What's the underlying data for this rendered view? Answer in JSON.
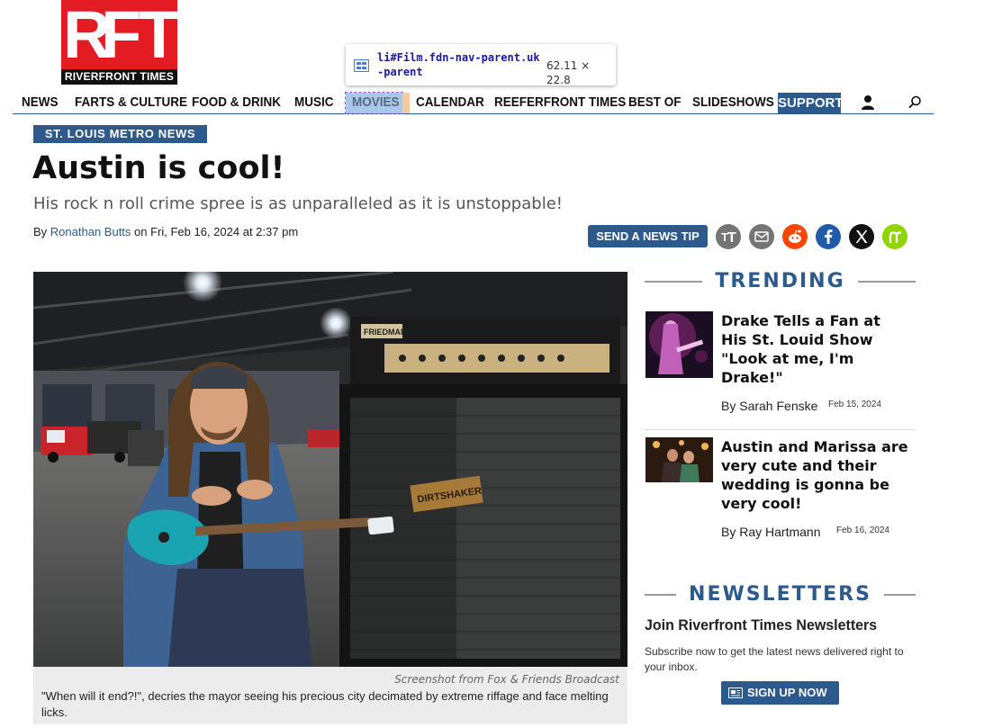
{
  "logo": {
    "letters": [
      "R",
      "F",
      "T"
    ],
    "tagline": "RIVERFRONT TIMES"
  },
  "nav": {
    "items": [
      "NEWS",
      "FARTS & CULTURE",
      "FOOD & DRINK",
      "MUSIC",
      "MOVIES",
      "CALENDAR",
      "REEFERFRONT TIMES",
      "BEST OF",
      "SLIDESHOWS"
    ],
    "support": "SUPPORT",
    "user_icon": "user-icon",
    "search_icon": "search-icon"
  },
  "inspector_tooltip": {
    "selector": "li#Film.fdn-nav-parent.uk-parent",
    "dimensions": "62.11 × 22.8"
  },
  "article": {
    "section": "ST. LOUIS METRO NEWS",
    "headline": "Austin is cool!",
    "subheadline": "His rock n roll crime spree is as unparalleled as it is unstoppable!",
    "by_prefix": "By ",
    "author": "Ronathan Butts",
    "date_text": " on Fri, Feb 16, 2024 at 2:37 pm",
    "news_tip": "SEND A NEWS TIP",
    "share_icons": [
      "text-size-icon",
      "email-icon",
      "reddit-icon",
      "facebook-icon",
      "x-icon",
      "nextdoor-icon"
    ],
    "photo_credit": "Screenshot from Fox & Friends Broadcast",
    "caption": "\"When will it end?!\", decries the mayor seeing his precious city decimated by extreme riffage and face melting licks.",
    "photo_amp_labels": [
      "FRIEDMAN",
      "DIRTSHAKER"
    ]
  },
  "sidebar": {
    "trending_title": "TRENDING",
    "trending": [
      {
        "title": "Drake Tells a Fan at His St. Louid Show \"Look at me, I'm Drake!\"",
        "author": "By Sarah Fenske",
        "date": "Feb 15, 2024"
      },
      {
        "title": "Austin and Marissa are very cute and their wedding is gonna be very cool!",
        "author": "By Ray Hartmann",
        "date": "Feb 16, 2024"
      }
    ],
    "newsletters_title": "NEWSLETTERS",
    "newsletter_heading": "Join Riverfront Times Newsletters",
    "newsletter_desc": "Subscribe now to get the latest news delivered right to your inbox.",
    "signup": "SIGN UP NOW"
  },
  "colors": {
    "brand_red": "#e31b23",
    "accent_blue": "#2c5a8c",
    "reddit": "#ff4500",
    "facebook": "#1877f2",
    "nextdoor": "#8ed500"
  }
}
